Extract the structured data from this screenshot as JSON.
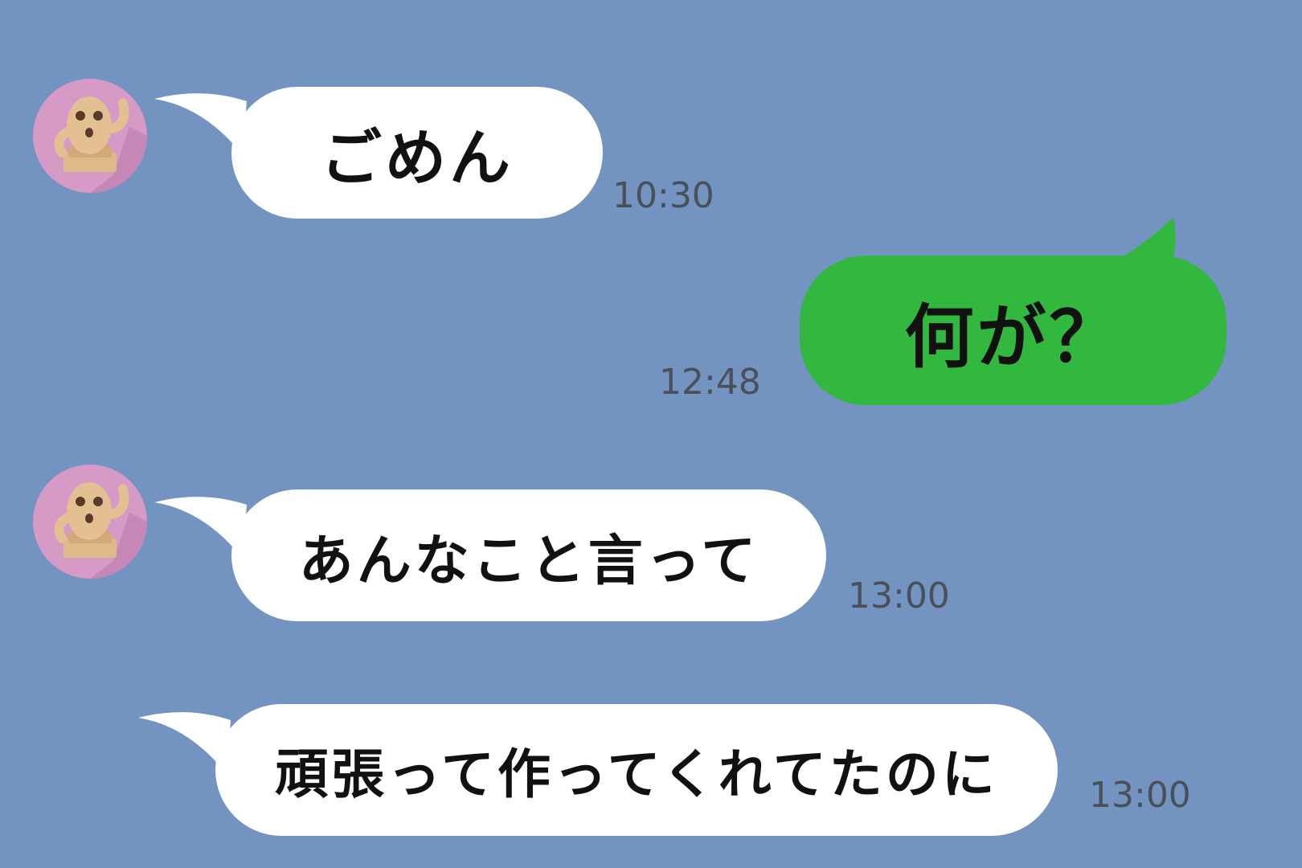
{
  "colors": {
    "background": "#7393c1",
    "incoming_bubble": "#ffffff",
    "outgoing_bubble": "#32b83f",
    "text": "#111111",
    "timestamp": "#4a5058",
    "avatar_bg": "#d59ac6"
  },
  "messages": [
    {
      "direction": "incoming",
      "text": "ごめん",
      "time": "10:30",
      "avatar": "haniwa-avatar-icon"
    },
    {
      "direction": "outgoing",
      "text": "何が？",
      "time": "12:48"
    },
    {
      "direction": "incoming",
      "text": "あんなこと言って",
      "time": "13:00",
      "avatar": "haniwa-avatar-icon"
    },
    {
      "direction": "incoming",
      "text": "頑張って作ってくれてたのに",
      "time": "13:00"
    }
  ]
}
